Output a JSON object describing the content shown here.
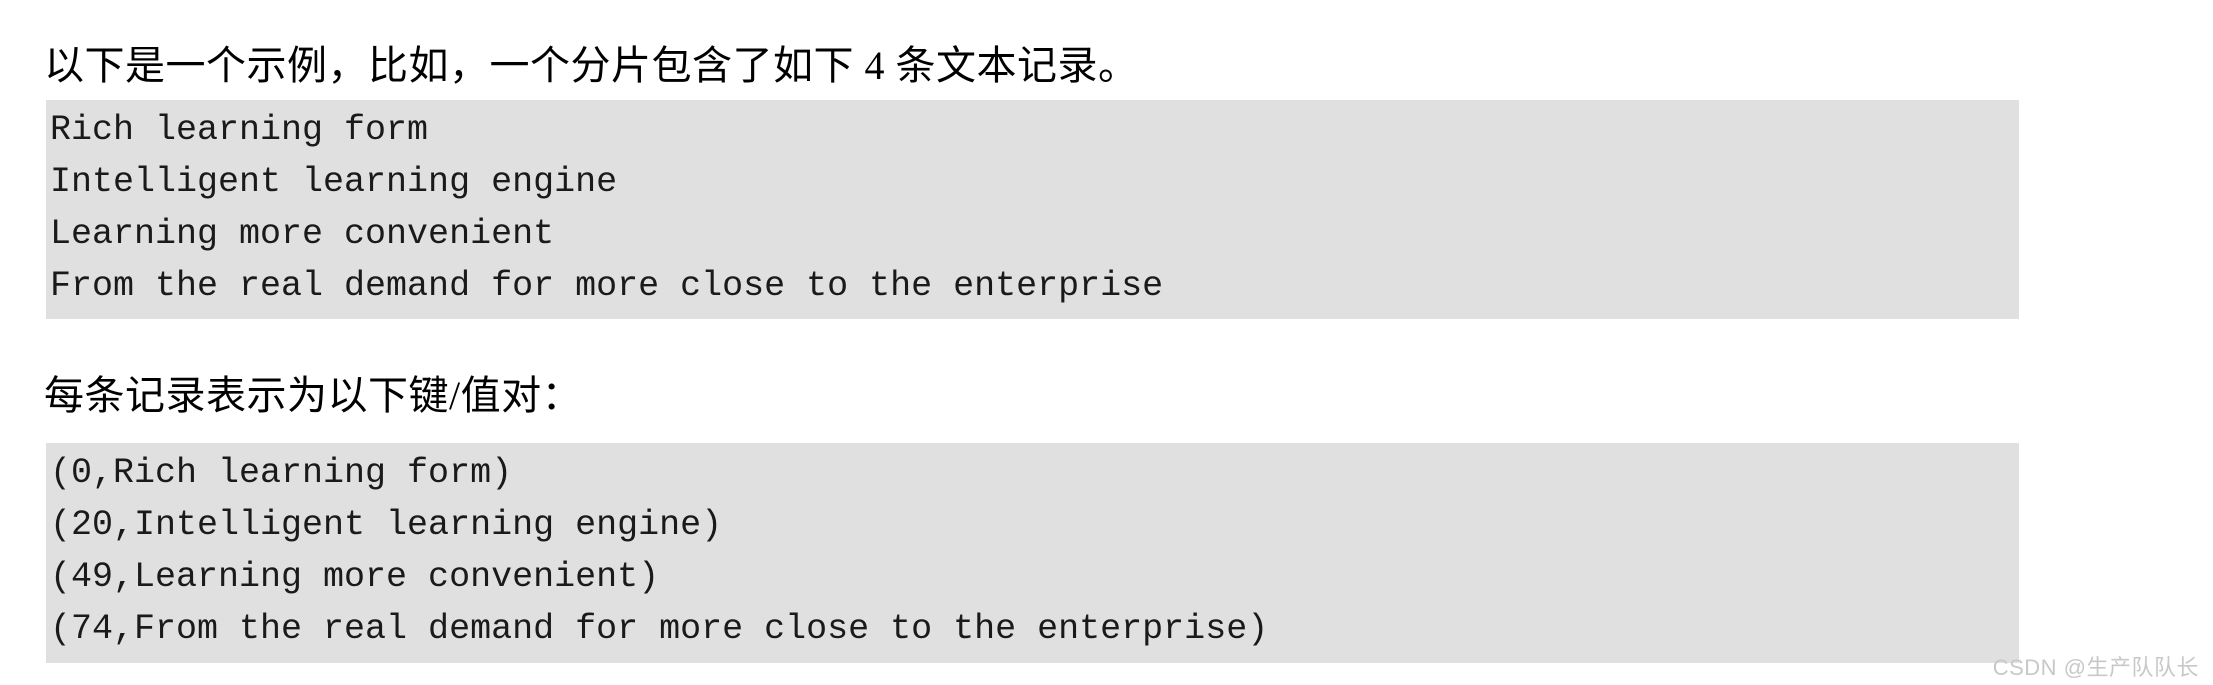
{
  "document": {
    "background_color": "#ffffff",
    "text_color": "#000000"
  },
  "paragraphs": {
    "intro": "以下是一个示例，比如，一个分片包含了如下 4 条文本记录。",
    "keyvalue_lead": "每条记录表示为以下键/值对："
  },
  "code_blocks": [
    {
      "name": "records",
      "background_color": "#e0e0e0",
      "lines": [
        "Rich learning form",
        "Intelligent learning engine",
        "Learning more convenient",
        "From the real demand for more close to the enterprise"
      ]
    },
    {
      "name": "keyvalue",
      "background_color": "#e0e0e0",
      "lines": [
        "(0,Rich learning form)",
        "(20,Intelligent learning engine)",
        "(49,Learning more convenient)",
        "(74,From the real demand for more close to the enterprise)"
      ]
    }
  ],
  "watermark": {
    "text": "CSDN @生产队队长",
    "color": "#c8c8c8"
  }
}
